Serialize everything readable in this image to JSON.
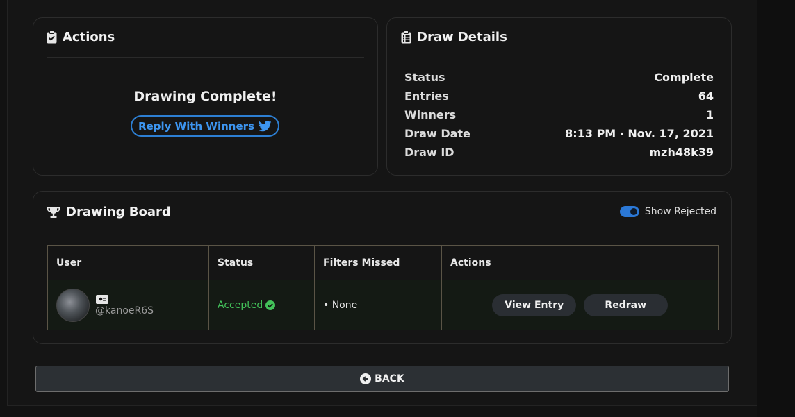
{
  "actions": {
    "title": "Actions",
    "complete_text": "Drawing Complete!",
    "reply_label": "Reply With Winners"
  },
  "details": {
    "title": "Draw Details",
    "rows": [
      {
        "label": "Status",
        "value": "Complete"
      },
      {
        "label": "Entries",
        "value": "64"
      },
      {
        "label": "Winners",
        "value": "1"
      },
      {
        "label": "Draw Date",
        "value": "8:13 PM · Nov. 17, 2021"
      },
      {
        "label": "Draw ID",
        "value": "mzh48k39"
      }
    ]
  },
  "board": {
    "title": "Drawing Board",
    "toggle_label": "Show Rejected",
    "toggle_on": true,
    "columns": [
      "User",
      "Status",
      "Filters Missed",
      "Actions"
    ],
    "rows": [
      {
        "handle": "@kanoeR6S",
        "status": "Accepted",
        "filters": "• None",
        "view_label": "View Entry",
        "redraw_label": "Redraw"
      }
    ]
  },
  "back_label": "BACK",
  "colors": {
    "accent": "#2d7fd3",
    "success": "#43c25a",
    "table_border": "#5a5446"
  }
}
